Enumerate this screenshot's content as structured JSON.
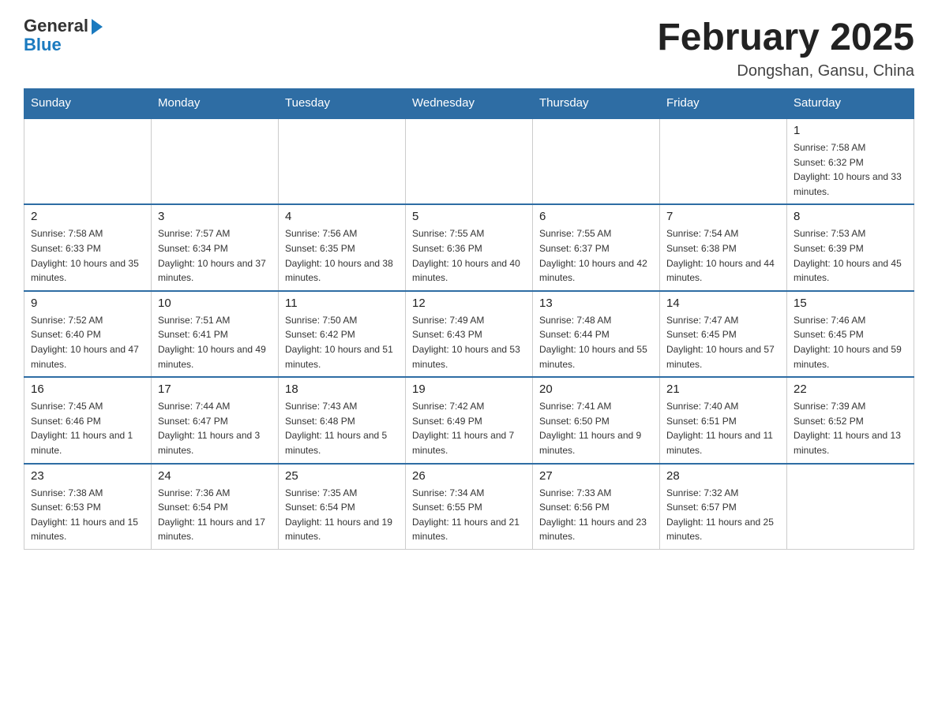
{
  "logo": {
    "general": "General",
    "blue": "Blue"
  },
  "title": "February 2025",
  "location": "Dongshan, Gansu, China",
  "weekdays": [
    "Sunday",
    "Monday",
    "Tuesday",
    "Wednesday",
    "Thursday",
    "Friday",
    "Saturday"
  ],
  "weeks": [
    [
      {
        "day": "",
        "info": ""
      },
      {
        "day": "",
        "info": ""
      },
      {
        "day": "",
        "info": ""
      },
      {
        "day": "",
        "info": ""
      },
      {
        "day": "",
        "info": ""
      },
      {
        "day": "",
        "info": ""
      },
      {
        "day": "1",
        "info": "Sunrise: 7:58 AM\nSunset: 6:32 PM\nDaylight: 10 hours and 33 minutes."
      }
    ],
    [
      {
        "day": "2",
        "info": "Sunrise: 7:58 AM\nSunset: 6:33 PM\nDaylight: 10 hours and 35 minutes."
      },
      {
        "day": "3",
        "info": "Sunrise: 7:57 AM\nSunset: 6:34 PM\nDaylight: 10 hours and 37 minutes."
      },
      {
        "day": "4",
        "info": "Sunrise: 7:56 AM\nSunset: 6:35 PM\nDaylight: 10 hours and 38 minutes."
      },
      {
        "day": "5",
        "info": "Sunrise: 7:55 AM\nSunset: 6:36 PM\nDaylight: 10 hours and 40 minutes."
      },
      {
        "day": "6",
        "info": "Sunrise: 7:55 AM\nSunset: 6:37 PM\nDaylight: 10 hours and 42 minutes."
      },
      {
        "day": "7",
        "info": "Sunrise: 7:54 AM\nSunset: 6:38 PM\nDaylight: 10 hours and 44 minutes."
      },
      {
        "day": "8",
        "info": "Sunrise: 7:53 AM\nSunset: 6:39 PM\nDaylight: 10 hours and 45 minutes."
      }
    ],
    [
      {
        "day": "9",
        "info": "Sunrise: 7:52 AM\nSunset: 6:40 PM\nDaylight: 10 hours and 47 minutes."
      },
      {
        "day": "10",
        "info": "Sunrise: 7:51 AM\nSunset: 6:41 PM\nDaylight: 10 hours and 49 minutes."
      },
      {
        "day": "11",
        "info": "Sunrise: 7:50 AM\nSunset: 6:42 PM\nDaylight: 10 hours and 51 minutes."
      },
      {
        "day": "12",
        "info": "Sunrise: 7:49 AM\nSunset: 6:43 PM\nDaylight: 10 hours and 53 minutes."
      },
      {
        "day": "13",
        "info": "Sunrise: 7:48 AM\nSunset: 6:44 PM\nDaylight: 10 hours and 55 minutes."
      },
      {
        "day": "14",
        "info": "Sunrise: 7:47 AM\nSunset: 6:45 PM\nDaylight: 10 hours and 57 minutes."
      },
      {
        "day": "15",
        "info": "Sunrise: 7:46 AM\nSunset: 6:45 PM\nDaylight: 10 hours and 59 minutes."
      }
    ],
    [
      {
        "day": "16",
        "info": "Sunrise: 7:45 AM\nSunset: 6:46 PM\nDaylight: 11 hours and 1 minute."
      },
      {
        "day": "17",
        "info": "Sunrise: 7:44 AM\nSunset: 6:47 PM\nDaylight: 11 hours and 3 minutes."
      },
      {
        "day": "18",
        "info": "Sunrise: 7:43 AM\nSunset: 6:48 PM\nDaylight: 11 hours and 5 minutes."
      },
      {
        "day": "19",
        "info": "Sunrise: 7:42 AM\nSunset: 6:49 PM\nDaylight: 11 hours and 7 minutes."
      },
      {
        "day": "20",
        "info": "Sunrise: 7:41 AM\nSunset: 6:50 PM\nDaylight: 11 hours and 9 minutes."
      },
      {
        "day": "21",
        "info": "Sunrise: 7:40 AM\nSunset: 6:51 PM\nDaylight: 11 hours and 11 minutes."
      },
      {
        "day": "22",
        "info": "Sunrise: 7:39 AM\nSunset: 6:52 PM\nDaylight: 11 hours and 13 minutes."
      }
    ],
    [
      {
        "day": "23",
        "info": "Sunrise: 7:38 AM\nSunset: 6:53 PM\nDaylight: 11 hours and 15 minutes."
      },
      {
        "day": "24",
        "info": "Sunrise: 7:36 AM\nSunset: 6:54 PM\nDaylight: 11 hours and 17 minutes."
      },
      {
        "day": "25",
        "info": "Sunrise: 7:35 AM\nSunset: 6:54 PM\nDaylight: 11 hours and 19 minutes."
      },
      {
        "day": "26",
        "info": "Sunrise: 7:34 AM\nSunset: 6:55 PM\nDaylight: 11 hours and 21 minutes."
      },
      {
        "day": "27",
        "info": "Sunrise: 7:33 AM\nSunset: 6:56 PM\nDaylight: 11 hours and 23 minutes."
      },
      {
        "day": "28",
        "info": "Sunrise: 7:32 AM\nSunset: 6:57 PM\nDaylight: 11 hours and 25 minutes."
      },
      {
        "day": "",
        "info": ""
      }
    ]
  ]
}
